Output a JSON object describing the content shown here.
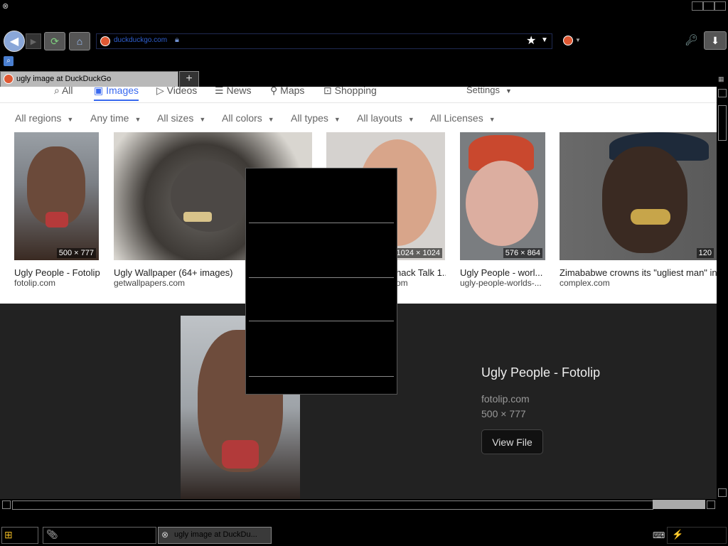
{
  "browser": {
    "url": "duckduckgo.com",
    "tab_title": "ugly image at DuckDuckGo",
    "new_tab_label": "+"
  },
  "nav": {
    "items": [
      "All",
      "Images",
      "Videos",
      "News",
      "Maps",
      "Shopping"
    ],
    "settings": "Settings"
  },
  "filters": [
    "All regions",
    "Any time",
    "All sizes",
    "All colors",
    "All types",
    "All layouts",
    "All Licenses"
  ],
  "results": [
    {
      "title": "Ugly People - Fotolip",
      "source": "fotolip.com",
      "dims": "500 × 777"
    },
    {
      "title": "Ugly Wallpaper (64+ images)",
      "source": "getwallpapers.com",
      "dims": ""
    },
    {
      "title": "hack Talk 1...",
      "source": "om",
      "dims": "1024 × 1024"
    },
    {
      "title": "Ugly People - worl...",
      "source": "ugly-people-worlds-...",
      "dims": "576 × 864"
    },
    {
      "title": "Zimababwe crowns its \"ugliest man\" in",
      "source": "complex.com",
      "dims": "120"
    }
  ],
  "detail": {
    "title": "Ugly People - Fotolip",
    "source": "fotolip.com",
    "dims": "500 × 777",
    "view_button": "View File"
  },
  "taskbar": {
    "window_label": "ugly image at DuckDu..."
  },
  "colors": {
    "accent": "#de5833",
    "link_blue": "#3969ef",
    "detail_bg": "#222222"
  }
}
